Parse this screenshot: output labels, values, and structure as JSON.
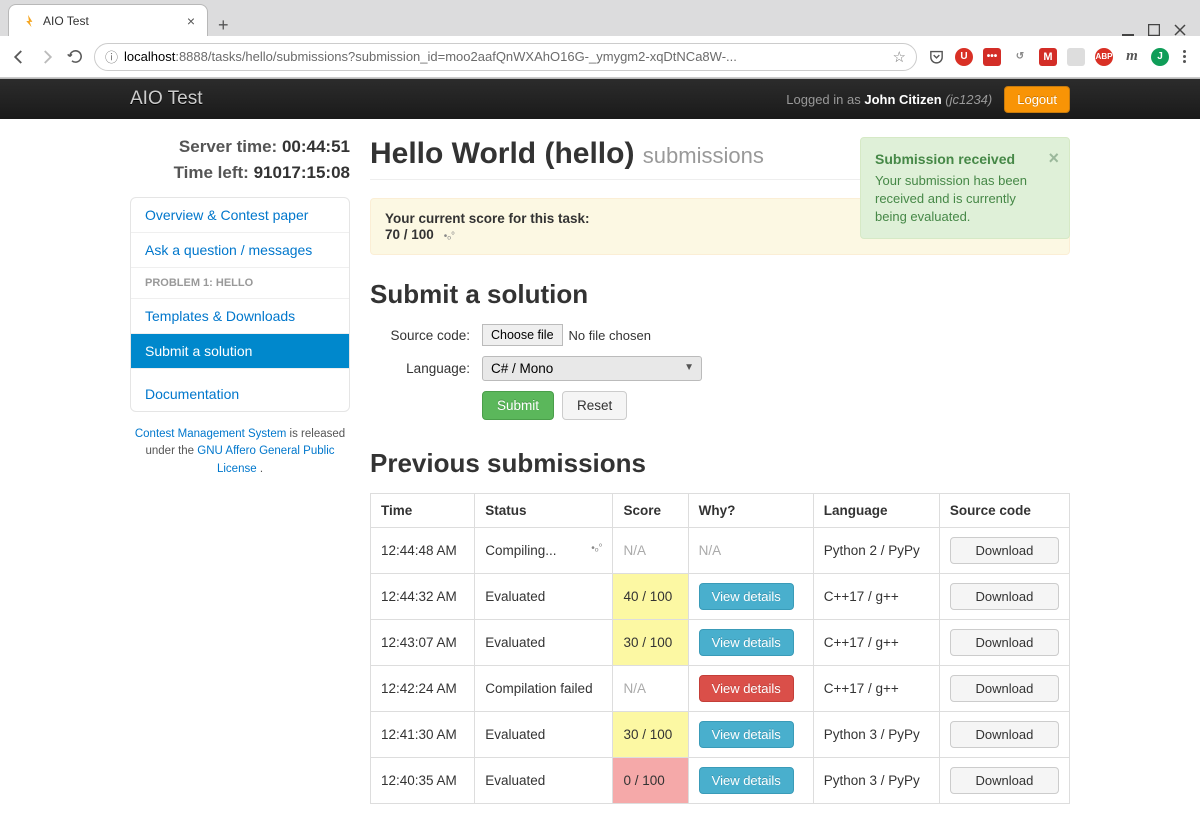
{
  "browser": {
    "tab_title": "AIO Test",
    "url_prefix_icon": "ⓘ",
    "url_host": "localhost",
    "url_rest": ":8888/tasks/hello/submissions?submission_id=moo2aafQnWXAhO16G-_ymygm2-xqDtNCa8W-..."
  },
  "navbar": {
    "brand": "AIO Test",
    "logged_in_prefix": "Logged in as ",
    "username": "John Citizen",
    "userid": "(jc1234)",
    "logout": "Logout"
  },
  "sidebar": {
    "server_time_label": "Server time:",
    "server_time": "00:44:51",
    "time_left_label": "Time left:",
    "time_left": "91017:15:08",
    "items": [
      {
        "label": "Overview & Contest paper",
        "type": "link"
      },
      {
        "label": "Ask a question / messages",
        "type": "link"
      },
      {
        "label": "PROBLEM 1: HELLO",
        "type": "header"
      },
      {
        "label": "Templates & Downloads",
        "type": "link"
      },
      {
        "label": "Submit a solution",
        "type": "link",
        "active": true
      },
      {
        "label": "Documentation",
        "type": "link"
      }
    ],
    "footer": {
      "cms": "Contest Management System",
      "mid": " is released under the ",
      "license": "GNU Affero General Public License",
      "end": " ."
    }
  },
  "main": {
    "title": "Hello World (hello)",
    "subtitle": "submissions",
    "alert": {
      "title": "Submission received",
      "body": "Your submission has been received and is currently being evaluated."
    },
    "score_label": "Your current score for this task:",
    "score_value": "70 / 100",
    "submit_heading": "Submit a solution",
    "source_label": "Source code:",
    "choose_file": "Choose file",
    "no_file": "No file chosen",
    "language_label": "Language:",
    "language_selected": "C# / Mono",
    "submit_btn": "Submit",
    "reset_btn": "Reset",
    "prev_heading": "Previous submissions",
    "table": {
      "headers": [
        "Time",
        "Status",
        "Score",
        "Why?",
        "Language",
        "Source code"
      ],
      "rows": [
        {
          "time": "12:44:48 AM",
          "status": "Compiling...",
          "status_spinner": true,
          "score": "N/A",
          "score_class": "na",
          "why": "N/A",
          "why_na": true,
          "lang": "Python 2 / PyPy",
          "download": "Download"
        },
        {
          "time": "12:44:32 AM",
          "status": "Evaluated",
          "score": "40 / 100",
          "score_class": "score-yellow",
          "why": "View details",
          "why_btn": "info",
          "lang": "C++17 / g++",
          "download": "Download"
        },
        {
          "time": "12:43:07 AM",
          "status": "Evaluated",
          "score": "30 / 100",
          "score_class": "score-yellow",
          "why": "View details",
          "why_btn": "info",
          "lang": "C++17 / g++",
          "download": "Download"
        },
        {
          "time": "12:42:24 AM",
          "status": "Compilation failed",
          "score": "N/A",
          "score_class": "na",
          "why": "View details",
          "why_btn": "danger",
          "lang": "C++17 / g++",
          "download": "Download"
        },
        {
          "time": "12:41:30 AM",
          "status": "Evaluated",
          "score": "30 / 100",
          "score_class": "score-yellow",
          "why": "View details",
          "why_btn": "info",
          "lang": "Python 3 / PyPy",
          "download": "Download"
        },
        {
          "time": "12:40:35 AM",
          "status": "Evaluated",
          "score": "0 / 100",
          "score_class": "score-red",
          "why": "View details",
          "why_btn": "info",
          "lang": "Python 3 / PyPy",
          "download": "Download"
        }
      ]
    }
  }
}
